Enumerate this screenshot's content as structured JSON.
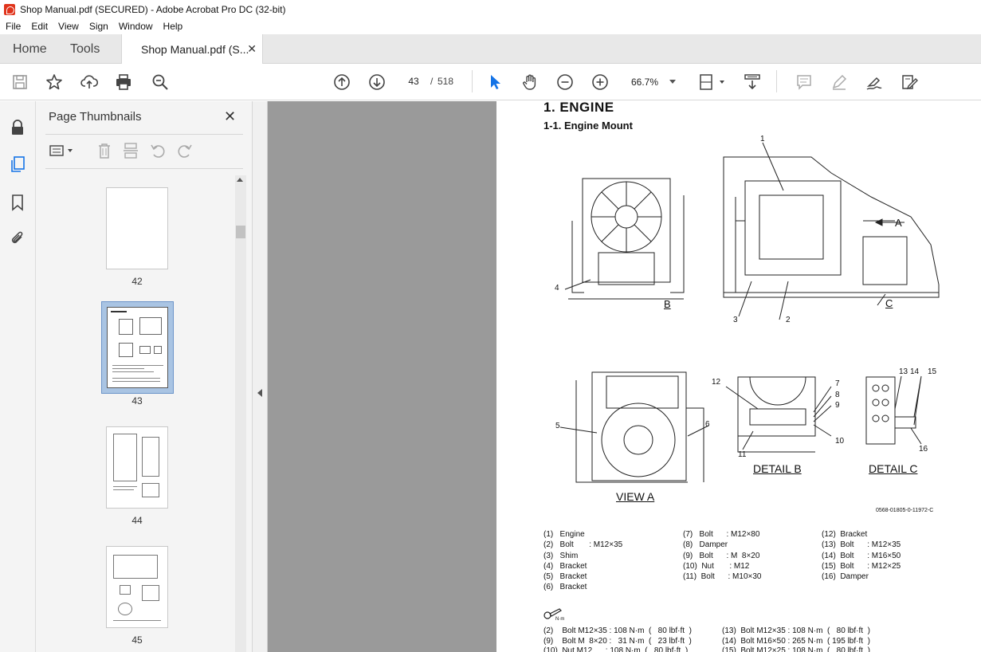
{
  "window": {
    "title": "Shop Manual.pdf (SECURED) - Adobe Acrobat Pro DC (32-bit)"
  },
  "menu": [
    "File",
    "Edit",
    "View",
    "Sign",
    "Window",
    "Help"
  ],
  "tabs": {
    "home": "Home",
    "tools": "Tools",
    "doc": "Shop Manual.pdf (S..."
  },
  "toolbar": {
    "page_current": "43",
    "page_sep": "/",
    "page_total": "518",
    "zoom": "66.7%"
  },
  "panel": {
    "title": "Page Thumbnails",
    "thumbs": [
      {
        "label": "42"
      },
      {
        "label": "43"
      },
      {
        "label": "44"
      },
      {
        "label": "45"
      }
    ]
  },
  "page": {
    "heading": "1. ENGINE",
    "subheading": "1-1. Engine Mount",
    "callouts": {
      "c1": "1",
      "c2": "2",
      "c3": "3",
      "c4": "4",
      "c5": "5",
      "c6": "6",
      "c7": "7",
      "c8": "8",
      "c9": "9",
      "c10": "10",
      "c11": "11",
      "c12": "12",
      "c13": "13",
      "c14": "14",
      "c15": "15",
      "c16": "16",
      "cA": "A",
      "cB": "B",
      "cC": "C"
    },
    "view_a": "VIEW A",
    "detail_b": "DETAIL  B",
    "detail_c": "DETAIL  C",
    "drawing_code": "0568-01805-0-11972-C",
    "legend_col1": "(1)   Engine\n(2)   Bolt       : M12×35\n(3)   Shim\n(4)   Bracket\n(5)   Bracket\n(6)   Bracket",
    "legend_col2": "(7)   Bolt      : M12×80\n(8)   Damper\n(9)   Bolt      : M  8×20\n(10)  Nut       : M12\n(11)  Bolt      : M10×30",
    "legend_col3": "(12)  Bracket\n(13)  Bolt      : M12×35\n(14)  Bolt      : M16×50\n(15)  Bolt      : M12×25\n(16)  Damper",
    "torque_icon_label": "N·m",
    "torque_col1": "(2)    Bolt M12×35 : 108 N·m  (   80 lbf·ft  )\n(9)    Bolt M  8×20 :   31 N·m  (   23 lbf·ft  )\n(10)  Nut M12      : 108 N·m  (   80 lbf·ft  )",
    "torque_col2": "(13)  Bolt M12×35 : 108 N·m  (   80 lbf·ft  )\n(14)  Bolt M16×50 : 265 N·m  ( 195 lbf·ft  )\n(15)  Bolt M12×25 : 108 N·m  (   80 lbf·ft  )"
  }
}
